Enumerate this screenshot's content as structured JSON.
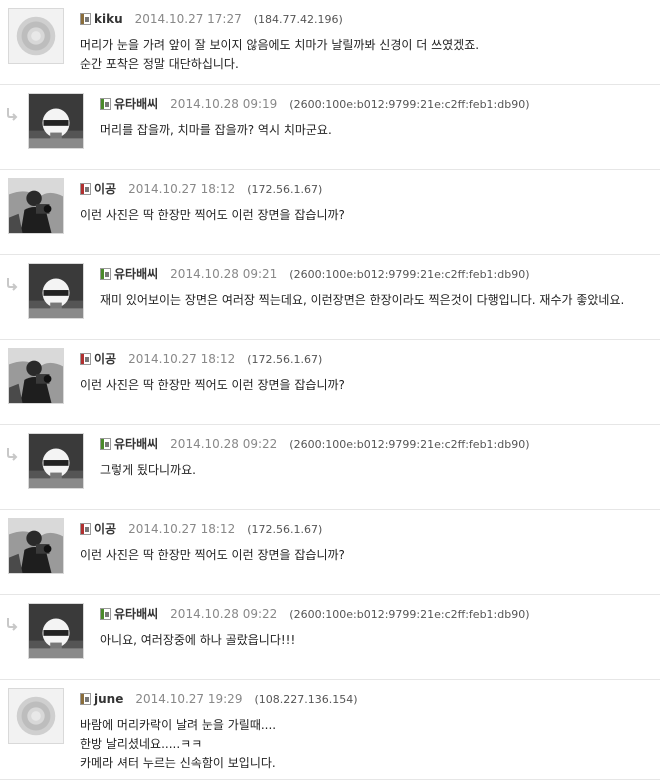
{
  "comments": [
    {
      "type": "top",
      "avatar": "default-avatar",
      "level_icon": "level-6-icon",
      "level_color": "#8a6d3b",
      "author": "kiku",
      "date": "2014.10.27 17:27",
      "ip": "(184.77.42.196)",
      "lines": [
        "머리가 눈을 가려 앞이 잘 보이지 않음에도 치마가 날릴까봐 신경이 더 쓰였겠죠.",
        "순간 포착은 정말 대단하십니다."
      ]
    },
    {
      "type": "reply",
      "avatar": "helmet-avatar",
      "level_icon": "level-11-icon",
      "level_color": "#4a8a2a",
      "author": "유타배씨",
      "date": "2014.10.28 09:19",
      "ip": "(2600:100e:b012:9799:21e:c2ff:feb1:db90)",
      "lines": [
        "머리를 잡을까, 치마를 잡을까? 역시 치마군요."
      ]
    },
    {
      "type": "top",
      "avatar": "photographer-avatar",
      "level_icon": "level-10-icon",
      "level_color": "#b03030",
      "author": "이공",
      "date": "2014.10.27 18:12",
      "ip": "(172.56.1.67)",
      "lines": [
        "이런 사진은 딱 한장만 찍어도 이런 장면을 잡습니까?"
      ]
    },
    {
      "type": "reply",
      "avatar": "helmet-avatar",
      "level_icon": "level-11-icon",
      "level_color": "#4a8a2a",
      "author": "유타배씨",
      "date": "2014.10.28 09:21",
      "ip": "(2600:100e:b012:9799:21e:c2ff:feb1:db90)",
      "lines": [
        "재미 있어보이는 장면은 여러장 찍는데요, 이런장면은 한장이라도 찍은것이 다행입니다. 재수가 좋았네요."
      ]
    },
    {
      "type": "top",
      "avatar": "photographer-avatar",
      "level_icon": "level-10-icon",
      "level_color": "#b03030",
      "author": "이공",
      "date": "2014.10.27 18:12",
      "ip": "(172.56.1.67)",
      "lines": [
        "이런 사진은 딱 한장만 찍어도 이런 장면을 잡습니까?"
      ]
    },
    {
      "type": "reply",
      "avatar": "helmet-avatar",
      "level_icon": "level-11-icon",
      "level_color": "#4a8a2a",
      "author": "유타배씨",
      "date": "2014.10.28 09:22",
      "ip": "(2600:100e:b012:9799:21e:c2ff:feb1:db90)",
      "lines": [
        "그렇게 됬다니까요."
      ]
    },
    {
      "type": "top",
      "avatar": "photographer-avatar",
      "level_icon": "level-10-icon",
      "level_color": "#b03030",
      "author": "이공",
      "date": "2014.10.27 18:12",
      "ip": "(172.56.1.67)",
      "lines": [
        "이런 사진은 딱 한장만 찍어도 이런 장면을 잡습니까?"
      ]
    },
    {
      "type": "reply",
      "avatar": "helmet-avatar",
      "level_icon": "level-11-icon",
      "level_color": "#4a8a2a",
      "author": "유타배씨",
      "date": "2014.10.28 09:22",
      "ip": "(2600:100e:b012:9799:21e:c2ff:feb1:db90)",
      "lines": [
        "아니요, 여러장중에 하나 골랐읍니다!!!"
      ]
    },
    {
      "type": "top",
      "avatar": "default-avatar",
      "level_icon": "level-6-icon",
      "level_color": "#8a6d3b",
      "author": "june",
      "date": "2014.10.27 19:29",
      "ip": "(108.227.136.154)",
      "lines": [
        "바람에 머리카락이 날려 눈을 가릴때....",
        "한방 날리셨네요.....ㅋㅋ",
        "카메라 셔터 누르는 신속함이 보입니다."
      ]
    }
  ]
}
